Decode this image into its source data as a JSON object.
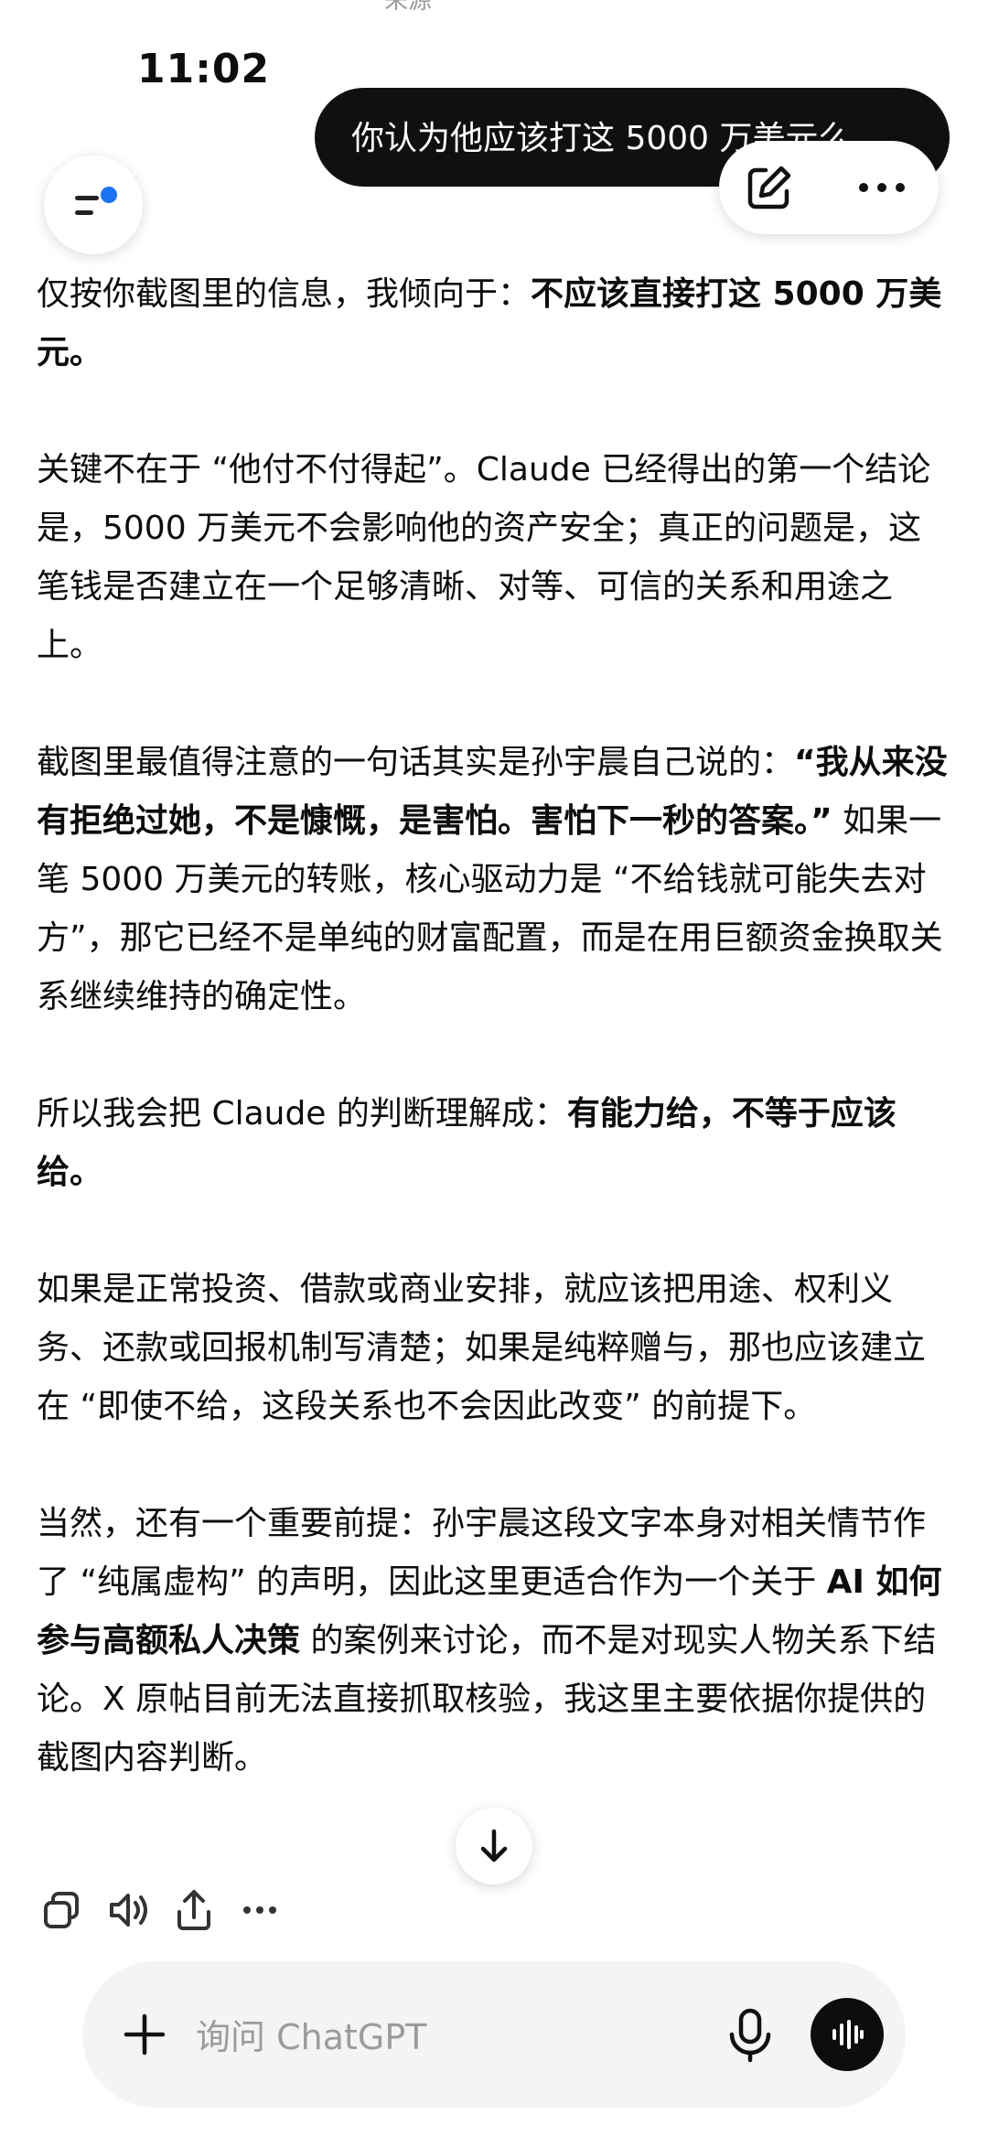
{
  "status_bar": {
    "time": "11:02",
    "partial_top_text": "来源"
  },
  "user_message": {
    "text": "你认为他应该打这 5000 万美元么"
  },
  "answer": {
    "p1_a": "仅按你截图里的信息，我倾向于：",
    "p1_b": "不应该直接打这 5000 万美元。",
    "p2": "关键不在于 “他付不付得起”。Claude 已经得出的第一个结论是，5000 万美元不会影响他的资产安全；真正的问题是，这笔钱是否建立在一个足够清晰、对等、可信的关系和用途之上。",
    "p3_a": "截图里最值得注意的一句话其实是孙宇晨自己说的：",
    "p3_b": "“我从来没有拒绝过她，不是慷慨，是害怕。害怕下一秒的答案。”",
    "p3_c": " 如果一笔 5000 万美元的转账，核心驱动力是 “不给钱就可能失去对方”，那它已经不是单纯的财富配置，而是在用巨额资金换取关系继续维持的确定性。",
    "p4_a": "所以我会把 Claude 的判断理解成：",
    "p4_b": "有能力给，不等于应该给。",
    "p5": "如果是正常投资、借款或商业安排，就应该把用途、权利义务、还款或回报机制写清楚；如果是纯粹赠与，那也应该建立在 “即使不给，这段关系也不会因此改变” 的前提下。",
    "p6_a": "当然，还有一个重要前提：孙宇晨这段文字本身对相关情节作了 “纯属虚构” 的声明，因此这里更适合作为一个关于 ",
    "p6_b": "AI 如何参与高额私人决策",
    "p6_c": " 的案例来讨论，而不是对现实人物关系下结论。X 原帖目前无法直接抓取核验，我这里主要依据你提供的截图内容判断。"
  },
  "composer": {
    "placeholder": "询问 ChatGPT"
  },
  "icons": {
    "menu": "sidebar-menu-icon",
    "edit": "new-chat-edit-icon",
    "more": "more-horizontal-icon",
    "copy": "copy-icon",
    "read_aloud": "speaker-icon",
    "share": "share-icon",
    "message_more": "more-horizontal-icon",
    "scroll": "arrow-down-icon",
    "plus": "plus-icon",
    "mic": "microphone-icon",
    "voice": "voice-mode-icon"
  },
  "colors": {
    "accent_dot": "#1a73f5",
    "bubble": "#101010",
    "composer_bg": "#f4f4f4"
  }
}
